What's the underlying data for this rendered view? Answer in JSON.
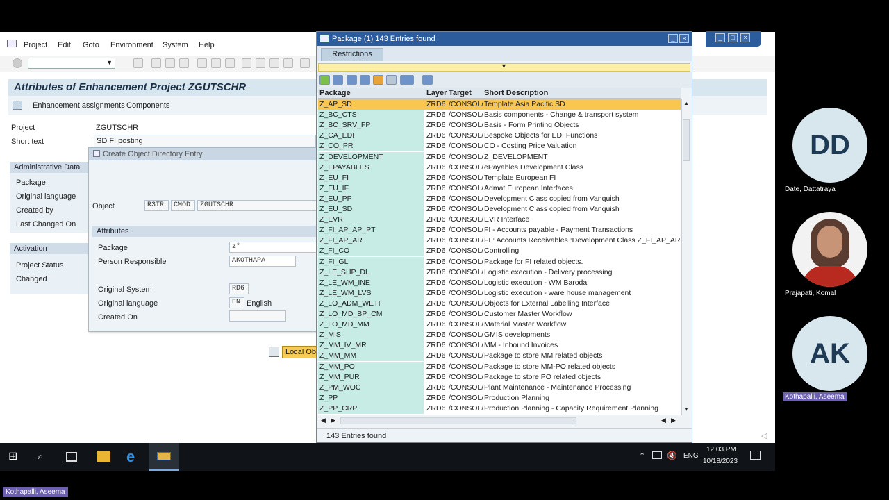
{
  "menu": [
    "Project",
    "Edit",
    "Goto",
    "Environment",
    "System",
    "Help"
  ],
  "page_title": "Attributes of Enhancement Project ZGUTSCHR",
  "app_toolbar": {
    "enhancement_assignments": "Enhancement assignments",
    "components": "Components"
  },
  "project_fields": {
    "project_label": "Project",
    "project_value": "ZGUTSCHR",
    "short_text_label": "Short text",
    "short_text_value": "SD FI posting"
  },
  "admin_section": {
    "title": "Administrative Data",
    "labels": [
      "Package",
      "Original language",
      "Created by",
      "Last Changed On"
    ]
  },
  "activation_section": {
    "title": "Activation",
    "labels": [
      "Project Status",
      "Changed"
    ]
  },
  "dialog": {
    "title": "Create Object Directory Entry",
    "object_label": "Object",
    "object_values": [
      "R3TR",
      "CMOD",
      "ZGUTSCHR"
    ],
    "attributes_title": "Attributes",
    "package_label": "Package",
    "package_value": "z*",
    "person_label": "Person Responsible",
    "person_value": "AKOTHAPA",
    "orig_system_label": "Original System",
    "orig_system_value": "RD6",
    "orig_lang_label": "Original language",
    "orig_lang_code": "EN",
    "orig_lang_name": "English",
    "created_on_label": "Created On",
    "local_object_button": "Local Obj"
  },
  "popup": {
    "title": "Package (1)  143 Entries found",
    "tab": "Restrictions",
    "columns": [
      "Package",
      "Layer",
      "Target",
      "Short Description"
    ],
    "rows": [
      [
        "Z_AP_SD",
        "ZRD6",
        "/CONSOL/",
        "Template Asia Pacific SD"
      ],
      [
        "Z_BC_CTS",
        "ZRD6",
        "/CONSOL/",
        "Basis components - Change & transport system"
      ],
      [
        "Z_BC_SRV_FP",
        "ZRD6",
        "/CONSOL/",
        "Basis - Form Printing Objects"
      ],
      [
        "Z_CA_EDI",
        "ZRD6",
        "/CONSOL/",
        "Bespoke Objects for EDI Functions"
      ],
      [
        "Z_CO_PR",
        "ZRD6",
        "/CONSOL/",
        "CO - Costing Price Valuation"
      ],
      [
        "Z_DEVELOPMENT",
        "ZRD6",
        "/CONSOL/",
        "Z_DEVELOPMENT"
      ],
      [
        "Z_EPAYABLES",
        "ZRD6",
        "/CONSOL/",
        "ePayables Development Class"
      ],
      [
        "Z_EU_FI",
        "ZRD6",
        "/CONSOL/",
        "Template European FI"
      ],
      [
        "Z_EU_IF",
        "ZRD6",
        "/CONSOL/",
        "Admat European Interfaces"
      ],
      [
        "Z_EU_PP",
        "ZRD6",
        "/CONSOL/",
        "Development Class copied from Vanquish"
      ],
      [
        "Z_EU_SD",
        "ZRD6",
        "/CONSOL/",
        "Development Class copied from Vanquish"
      ],
      [
        "Z_EVR",
        "ZRD6",
        "/CONSOL/",
        "EVR Interface"
      ],
      [
        "Z_FI_AP_AP_PT",
        "ZRD6",
        "/CONSOL/",
        "FI - Accounts payable - Payment Transactions"
      ],
      [
        "Z_FI_AP_AR",
        "ZRD6",
        "/CONSOL/",
        "FI : Accounts Receivables :Development Class Z_FI_AP_AR"
      ],
      [
        "Z_FI_CO",
        "ZRD6",
        "/CONSOL/",
        "Controlling"
      ],
      [
        "Z_FI_GL",
        "ZRD6",
        "/CONSOL/",
        "Package for FI related objects."
      ],
      [
        "Z_LE_SHP_DL",
        "ZRD6",
        "/CONSOL/",
        "Logistic execution - Delivery processing"
      ],
      [
        "Z_LE_WM_INE",
        "ZRD6",
        "/CONSOL/",
        "Logistic execution - WM Baroda"
      ],
      [
        "Z_LE_WM_LVS",
        "ZRD6",
        "/CONSOL/",
        "Logistic execution - ware house management"
      ],
      [
        "Z_LO_ADM_WETI",
        "ZRD6",
        "/CONSOL/",
        "Objects for External Labelling Interface"
      ],
      [
        "Z_LO_MD_BP_CM",
        "ZRD6",
        "/CONSOL/",
        "Customer Master Workflow"
      ],
      [
        "Z_LO_MD_MM",
        "ZRD6",
        "/CONSOL/",
        "Material Master Workflow"
      ],
      [
        "Z_MIS",
        "ZRD6",
        "/CONSOL/",
        "GMIS developments"
      ],
      [
        "Z_MM_IV_MR",
        "ZRD6",
        "/CONSOL/",
        "MM - Inbound Invoices"
      ],
      [
        "Z_MM_MM",
        "ZRD6",
        "/CONSOL/",
        "Package to store MM related objects"
      ],
      [
        "Z_MM_PO",
        "ZRD6",
        "/CONSOL/",
        "Package to store MM-PO related objects"
      ],
      [
        "Z_MM_PUR",
        "ZRD6",
        "/CONSOL/",
        "Package to store PO related objects"
      ],
      [
        "Z_PM_WOC",
        "ZRD6",
        "/CONSOL/",
        "Plant Maintenance - Maintenance Processing"
      ],
      [
        "Z_PP",
        "ZRD6",
        "/CONSOL/",
        "Production Planning"
      ],
      [
        "Z_PP_CRP",
        "ZRD6",
        "/CONSOL/",
        "Production Planning - Capacity Requirement Planning"
      ]
    ],
    "status": "143 Entries found"
  },
  "taskbar": {
    "language": "ENG",
    "time": "12:03 PM",
    "date": "10/18/2023"
  },
  "participants": [
    {
      "initials": "DD",
      "name": "Date, Dattatraya"
    },
    {
      "initials": "",
      "name": "Prajapati, Komal"
    },
    {
      "initials": "AK",
      "name": "Kothapalli, Aseema"
    }
  ],
  "presenter_label": "Kothapalli, Aseema"
}
